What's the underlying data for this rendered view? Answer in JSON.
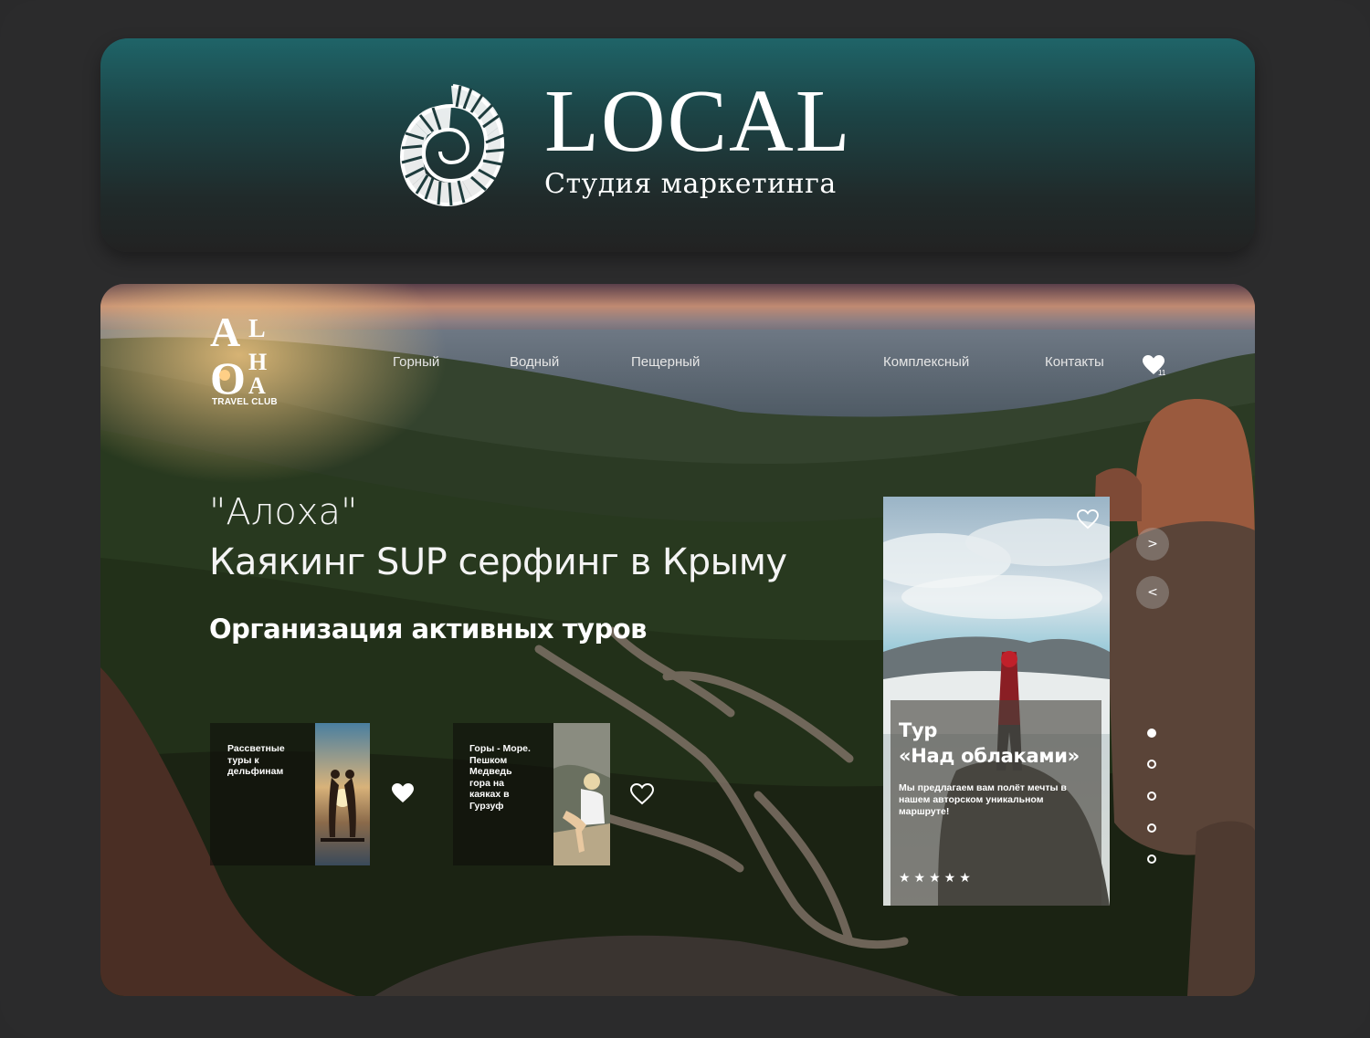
{
  "banner": {
    "brand": "LOCAL",
    "tagline": "Студия маркетинга"
  },
  "site": {
    "logo_letters": [
      "A",
      "L",
      "O",
      "H",
      "A"
    ],
    "logo_caption": "TRAVEL CLUB",
    "nav": [
      "Горный",
      "Водный",
      "Пещерный",
      "Комплексный",
      "Контакты"
    ],
    "favorites_count": "11",
    "hero_line1": "\"Алоха\"",
    "hero_line2": "Каякинг SUP серфинг в Крыму",
    "hero_subtitle": "Организация активных туров",
    "cards": [
      {
        "lines": [
          "Рассветные",
          "туры к",
          "дельфинам"
        ],
        "heart": "filled-heart-icon"
      },
      {
        "lines": [
          "Горы - Море.",
          "Пешком",
          "Медведь",
          "гора на",
          "каяках в",
          "Гурзуф"
        ],
        "heart": "outline-heart-icon"
      }
    ],
    "tour": {
      "title_line1": "Тур",
      "title_line2": "«Над облаками»",
      "description": "Мы предлагаем вам полёт мечты в нашем авторском уникальном маршруте!",
      "stars": "★★★★★"
    },
    "arrows": {
      "next": ">",
      "prev": "<"
    },
    "slider_dots": 5,
    "active_dot": 1
  },
  "colors": {
    "page_bg": "#2b2b2c",
    "banner_top": "#1f6468",
    "banner_bottom": "#222222",
    "text": "#ffffff"
  }
}
